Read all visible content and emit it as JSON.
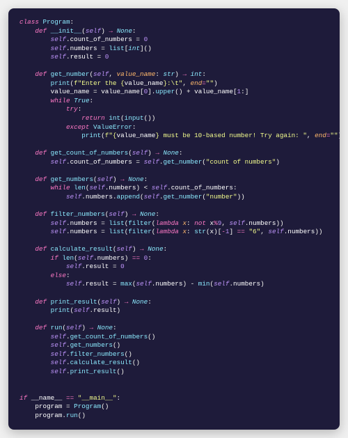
{
  "code": {
    "lines": [
      [
        [
          "kw",
          "class "
        ],
        [
          "cls",
          "Program"
        ],
        [
          "punc",
          ":"
        ]
      ],
      [
        [
          "",
          "    "
        ],
        [
          "kw",
          "def "
        ],
        [
          "fname",
          "__init__"
        ],
        [
          "punc",
          "("
        ],
        [
          "self",
          "self"
        ],
        [
          "punc",
          ") "
        ],
        [
          "op",
          "→"
        ],
        [
          "punc",
          " "
        ],
        [
          "type",
          "None"
        ],
        [
          "punc",
          ":"
        ]
      ],
      [
        [
          "",
          "        "
        ],
        [
          "self",
          "self"
        ],
        [
          "punc",
          "."
        ],
        [
          "attr",
          "count_of_numbers"
        ],
        [
          "punc",
          " = "
        ],
        [
          "num",
          "0"
        ]
      ],
      [
        [
          "",
          "        "
        ],
        [
          "self",
          "self"
        ],
        [
          "punc",
          "."
        ],
        [
          "attr",
          "numbers"
        ],
        [
          "punc",
          " = "
        ],
        [
          "builtin",
          "list"
        ],
        [
          "punc",
          "["
        ],
        [
          "type",
          "int"
        ],
        [
          "punc",
          "]()"
        ]
      ],
      [
        [
          "",
          "        "
        ],
        [
          "self",
          "self"
        ],
        [
          "punc",
          "."
        ],
        [
          "attr",
          "result"
        ],
        [
          "punc",
          " = "
        ],
        [
          "num",
          "0"
        ]
      ],
      [
        [
          "",
          ""
        ]
      ],
      [
        [
          "",
          "    "
        ],
        [
          "kw",
          "def "
        ],
        [
          "fname",
          "get_number"
        ],
        [
          "punc",
          "("
        ],
        [
          "self",
          "self"
        ],
        [
          "punc",
          ", "
        ],
        [
          "param",
          "value_name"
        ],
        [
          "punc",
          ": "
        ],
        [
          "type",
          "str"
        ],
        [
          "punc",
          ") "
        ],
        [
          "op",
          "→"
        ],
        [
          "punc",
          " "
        ],
        [
          "type",
          "int"
        ],
        [
          "punc",
          ":"
        ]
      ],
      [
        [
          "",
          "        "
        ],
        [
          "builtin",
          "print"
        ],
        [
          "punc",
          "("
        ],
        [
          "str",
          "f\"Enter the {"
        ],
        [
          "attr",
          "value_name"
        ],
        [
          "str",
          "}:\\t\""
        ],
        [
          "punc",
          ", "
        ],
        [
          "param",
          "end"
        ],
        [
          "op",
          "="
        ],
        [
          "str",
          "\"\""
        ],
        [
          "punc",
          ")"
        ]
      ],
      [
        [
          "",
          "        "
        ],
        [
          "attr",
          "value_name"
        ],
        [
          "punc",
          " = "
        ],
        [
          "attr",
          "value_name"
        ],
        [
          "punc",
          "["
        ],
        [
          "num",
          "0"
        ],
        [
          "punc",
          "]."
        ],
        [
          "fname",
          "upper"
        ],
        [
          "punc",
          "() + "
        ],
        [
          "attr",
          "value_name"
        ],
        [
          "punc",
          "["
        ],
        [
          "num",
          "1"
        ],
        [
          "punc",
          ":]"
        ]
      ],
      [
        [
          "",
          "        "
        ],
        [
          "kw",
          "while "
        ],
        [
          "type",
          "True"
        ],
        [
          "punc",
          ":"
        ]
      ],
      [
        [
          "",
          "            "
        ],
        [
          "kw",
          "try"
        ],
        [
          "punc",
          ":"
        ]
      ],
      [
        [
          "",
          "                "
        ],
        [
          "kw",
          "return "
        ],
        [
          "builtin",
          "int"
        ],
        [
          "punc",
          "("
        ],
        [
          "builtin",
          "input"
        ],
        [
          "punc",
          "())"
        ]
      ],
      [
        [
          "",
          "            "
        ],
        [
          "kw",
          "except "
        ],
        [
          "cls",
          "ValueError"
        ],
        [
          "punc",
          ":"
        ]
      ],
      [
        [
          "",
          "                "
        ],
        [
          "builtin",
          "print"
        ],
        [
          "punc",
          "("
        ],
        [
          "str",
          "f\"{"
        ],
        [
          "attr",
          "value_name"
        ],
        [
          "str",
          "} must be 10-based number! Try again: \""
        ],
        [
          "punc",
          ", "
        ],
        [
          "param",
          "end"
        ],
        [
          "op",
          "="
        ],
        [
          "str",
          "\"\""
        ],
        [
          "punc",
          ")"
        ]
      ],
      [
        [
          "",
          ""
        ]
      ],
      [
        [
          "",
          "    "
        ],
        [
          "kw",
          "def "
        ],
        [
          "fname",
          "get_count_of_numbers"
        ],
        [
          "punc",
          "("
        ],
        [
          "self",
          "self"
        ],
        [
          "punc",
          ") "
        ],
        [
          "op",
          "→"
        ],
        [
          "punc",
          " "
        ],
        [
          "type",
          "None"
        ],
        [
          "punc",
          ":"
        ]
      ],
      [
        [
          "",
          "        "
        ],
        [
          "self",
          "self"
        ],
        [
          "punc",
          "."
        ],
        [
          "attr",
          "count_of_numbers"
        ],
        [
          "punc",
          " = "
        ],
        [
          "self",
          "self"
        ],
        [
          "punc",
          "."
        ],
        [
          "fname",
          "get_number"
        ],
        [
          "punc",
          "("
        ],
        [
          "str",
          "\"count of numbers\""
        ],
        [
          "punc",
          ")"
        ]
      ],
      [
        [
          "",
          ""
        ]
      ],
      [
        [
          "",
          "    "
        ],
        [
          "kw",
          "def "
        ],
        [
          "fname",
          "get_numbers"
        ],
        [
          "punc",
          "("
        ],
        [
          "self",
          "self"
        ],
        [
          "punc",
          ") "
        ],
        [
          "op",
          "→"
        ],
        [
          "punc",
          " "
        ],
        [
          "type",
          "None"
        ],
        [
          "punc",
          ":"
        ]
      ],
      [
        [
          "",
          "        "
        ],
        [
          "kw",
          "while "
        ],
        [
          "builtin",
          "len"
        ],
        [
          "punc",
          "("
        ],
        [
          "self",
          "self"
        ],
        [
          "punc",
          "."
        ],
        [
          "attr",
          "numbers"
        ],
        [
          "punc",
          ") < "
        ],
        [
          "self",
          "self"
        ],
        [
          "punc",
          "."
        ],
        [
          "attr",
          "count_of_numbers"
        ],
        [
          "punc",
          ":"
        ]
      ],
      [
        [
          "",
          "            "
        ],
        [
          "self",
          "self"
        ],
        [
          "punc",
          "."
        ],
        [
          "attr",
          "numbers"
        ],
        [
          "punc",
          "."
        ],
        [
          "fname",
          "append"
        ],
        [
          "punc",
          "("
        ],
        [
          "self",
          "self"
        ],
        [
          "punc",
          "."
        ],
        [
          "fname",
          "get_number"
        ],
        [
          "punc",
          "("
        ],
        [
          "str",
          "\"number\""
        ],
        [
          "punc",
          "))"
        ]
      ],
      [
        [
          "",
          ""
        ]
      ],
      [
        [
          "",
          "    "
        ],
        [
          "kw",
          "def "
        ],
        [
          "fname",
          "filter_numbers"
        ],
        [
          "punc",
          "("
        ],
        [
          "self",
          "self"
        ],
        [
          "punc",
          ") "
        ],
        [
          "op",
          "→"
        ],
        [
          "punc",
          " "
        ],
        [
          "type",
          "None"
        ],
        [
          "punc",
          ":"
        ]
      ],
      [
        [
          "",
          "        "
        ],
        [
          "self",
          "self"
        ],
        [
          "punc",
          "."
        ],
        [
          "attr",
          "numbers"
        ],
        [
          "punc",
          " = "
        ],
        [
          "builtin",
          "list"
        ],
        [
          "punc",
          "("
        ],
        [
          "builtin",
          "filter"
        ],
        [
          "punc",
          "("
        ],
        [
          "kw",
          "lambda "
        ],
        [
          "param",
          "x"
        ],
        [
          "punc",
          ": "
        ],
        [
          "kw",
          "not "
        ],
        [
          "attr",
          "x"
        ],
        [
          "op",
          "%"
        ],
        [
          "num",
          "9"
        ],
        [
          "punc",
          ", "
        ],
        [
          "self",
          "self"
        ],
        [
          "punc",
          "."
        ],
        [
          "attr",
          "numbers"
        ],
        [
          "punc",
          "))"
        ]
      ],
      [
        [
          "",
          "        "
        ],
        [
          "self",
          "self"
        ],
        [
          "punc",
          "."
        ],
        [
          "attr",
          "numbers"
        ],
        [
          "punc",
          " = "
        ],
        [
          "builtin",
          "list"
        ],
        [
          "punc",
          "("
        ],
        [
          "builtin",
          "filter"
        ],
        [
          "punc",
          "("
        ],
        [
          "kw",
          "lambda "
        ],
        [
          "param",
          "x"
        ],
        [
          "punc",
          ": "
        ],
        [
          "builtin",
          "str"
        ],
        [
          "punc",
          "("
        ],
        [
          "attr",
          "x"
        ],
        [
          "punc",
          ")["
        ],
        [
          "op",
          "-"
        ],
        [
          "num",
          "1"
        ],
        [
          "punc",
          "] "
        ],
        [
          "op",
          "=="
        ],
        [
          "punc",
          " "
        ],
        [
          "str",
          "\"6\""
        ],
        [
          "punc",
          ", "
        ],
        [
          "self",
          "self"
        ],
        [
          "punc",
          "."
        ],
        [
          "attr",
          "numbers"
        ],
        [
          "punc",
          "))"
        ]
      ],
      [
        [
          "",
          ""
        ]
      ],
      [
        [
          "",
          "    "
        ],
        [
          "kw",
          "def "
        ],
        [
          "fname",
          "calculate_result"
        ],
        [
          "punc",
          "("
        ],
        [
          "self",
          "self"
        ],
        [
          "punc",
          ") "
        ],
        [
          "op",
          "→"
        ],
        [
          "punc",
          " "
        ],
        [
          "type",
          "None"
        ],
        [
          "punc",
          ":"
        ]
      ],
      [
        [
          "",
          "        "
        ],
        [
          "kw",
          "if "
        ],
        [
          "builtin",
          "len"
        ],
        [
          "punc",
          "("
        ],
        [
          "self",
          "self"
        ],
        [
          "punc",
          "."
        ],
        [
          "attr",
          "numbers"
        ],
        [
          "punc",
          ") "
        ],
        [
          "op",
          "=="
        ],
        [
          "punc",
          " "
        ],
        [
          "num",
          "0"
        ],
        [
          "punc",
          ":"
        ]
      ],
      [
        [
          "",
          "            "
        ],
        [
          "self",
          "self"
        ],
        [
          "punc",
          "."
        ],
        [
          "attr",
          "result"
        ],
        [
          "punc",
          " = "
        ],
        [
          "num",
          "0"
        ]
      ],
      [
        [
          "",
          "        "
        ],
        [
          "kw",
          "else"
        ],
        [
          "punc",
          ":"
        ]
      ],
      [
        [
          "",
          "            "
        ],
        [
          "self",
          "self"
        ],
        [
          "punc",
          "."
        ],
        [
          "attr",
          "result"
        ],
        [
          "punc",
          " = "
        ],
        [
          "builtin",
          "max"
        ],
        [
          "punc",
          "("
        ],
        [
          "self",
          "self"
        ],
        [
          "punc",
          "."
        ],
        [
          "attr",
          "numbers"
        ],
        [
          "punc",
          ") - "
        ],
        [
          "builtin",
          "min"
        ],
        [
          "punc",
          "("
        ],
        [
          "self",
          "self"
        ],
        [
          "punc",
          "."
        ],
        [
          "attr",
          "numbers"
        ],
        [
          "punc",
          ")"
        ]
      ],
      [
        [
          "",
          ""
        ]
      ],
      [
        [
          "",
          "    "
        ],
        [
          "kw",
          "def "
        ],
        [
          "fname",
          "print_result"
        ],
        [
          "punc",
          "("
        ],
        [
          "self",
          "self"
        ],
        [
          "punc",
          ") "
        ],
        [
          "op",
          "→"
        ],
        [
          "punc",
          " "
        ],
        [
          "type",
          "None"
        ],
        [
          "punc",
          ":"
        ]
      ],
      [
        [
          "",
          "        "
        ],
        [
          "builtin",
          "print"
        ],
        [
          "punc",
          "("
        ],
        [
          "self",
          "self"
        ],
        [
          "punc",
          "."
        ],
        [
          "attr",
          "result"
        ],
        [
          "punc",
          ")"
        ]
      ],
      [
        [
          "",
          ""
        ]
      ],
      [
        [
          "",
          "    "
        ],
        [
          "kw",
          "def "
        ],
        [
          "fname",
          "run"
        ],
        [
          "punc",
          "("
        ],
        [
          "self",
          "self"
        ],
        [
          "punc",
          ") "
        ],
        [
          "op",
          "→"
        ],
        [
          "punc",
          " "
        ],
        [
          "type",
          "None"
        ],
        [
          "punc",
          ":"
        ]
      ],
      [
        [
          "",
          "        "
        ],
        [
          "self",
          "self"
        ],
        [
          "punc",
          "."
        ],
        [
          "fname",
          "get_count_of_numbers"
        ],
        [
          "punc",
          "()"
        ]
      ],
      [
        [
          "",
          "        "
        ],
        [
          "self",
          "self"
        ],
        [
          "punc",
          "."
        ],
        [
          "fname",
          "get_numbers"
        ],
        [
          "punc",
          "()"
        ]
      ],
      [
        [
          "",
          "        "
        ],
        [
          "self",
          "self"
        ],
        [
          "punc",
          "."
        ],
        [
          "fname",
          "filter_numbers"
        ],
        [
          "punc",
          "()"
        ]
      ],
      [
        [
          "",
          "        "
        ],
        [
          "self",
          "self"
        ],
        [
          "punc",
          "."
        ],
        [
          "fname",
          "calculate_result"
        ],
        [
          "punc",
          "()"
        ]
      ],
      [
        [
          "",
          "        "
        ],
        [
          "self",
          "self"
        ],
        [
          "punc",
          "."
        ],
        [
          "fname",
          "print_result"
        ],
        [
          "punc",
          "()"
        ]
      ],
      [
        [
          "",
          ""
        ]
      ],
      [
        [
          "",
          ""
        ]
      ],
      [
        [
          "kw",
          "if "
        ],
        [
          "attr",
          "__name__"
        ],
        [
          "punc",
          " "
        ],
        [
          "op",
          "=="
        ],
        [
          "punc",
          " "
        ],
        [
          "str",
          "\"__main__\""
        ],
        [
          "punc",
          ":"
        ]
      ],
      [
        [
          "",
          "    "
        ],
        [
          "attr",
          "program"
        ],
        [
          "punc",
          " = "
        ],
        [
          "cls",
          "Program"
        ],
        [
          "punc",
          "()"
        ]
      ],
      [
        [
          "",
          "    "
        ],
        [
          "attr",
          "program"
        ],
        [
          "punc",
          "."
        ],
        [
          "fname",
          "run"
        ],
        [
          "punc",
          "()"
        ]
      ]
    ]
  }
}
